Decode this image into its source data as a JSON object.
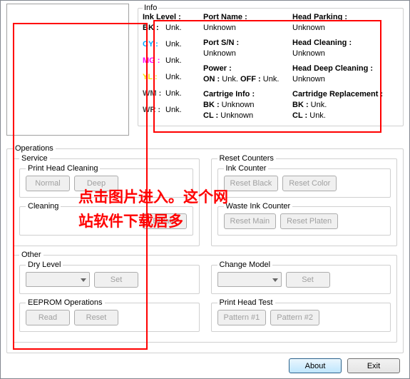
{
  "info": {
    "legend": "Info",
    "ink_level_label": "Ink Level :",
    "inks": {
      "bk": {
        "label": "BK :",
        "value": "Unk."
      },
      "cy": {
        "label": "CY :",
        "value": "Unk."
      },
      "mg": {
        "label": "MG :",
        "value": "Unk."
      },
      "yl": {
        "label": "YL :",
        "value": "Unk."
      },
      "wm": {
        "label": "WM :",
        "value": "Unk."
      },
      "wr": {
        "label": "WR :",
        "value": "Unk."
      }
    },
    "port_name": {
      "label": "Port Name :",
      "value": "Unknown"
    },
    "port_sn": {
      "label": "Port S/N :",
      "value": "Unknown"
    },
    "power": {
      "label": "Power :",
      "on_label": "ON :",
      "on_value": "Unk.",
      "off_label": "OFF :",
      "off_value": "Unk."
    },
    "cartridge_info": {
      "label": "Cartrige Info :",
      "bk_label": "BK :",
      "bk_value": "Unknown",
      "cl_label": "CL :",
      "cl_value": "Unknown"
    },
    "head_parking": {
      "label": "Head Parking :",
      "value": "Unknown"
    },
    "head_cleaning": {
      "label": "Head Cleaning :",
      "value": "Unknown"
    },
    "head_deep": {
      "label": "Head Deep Cleaning :",
      "value": "Unknown"
    },
    "cart_replace": {
      "label": "Cartridge Replacement :",
      "bk_label": "BK :",
      "bk_value": "Unk.",
      "cl_label": "CL :",
      "cl_value": "Unk."
    }
  },
  "operations": {
    "legend": "Operations",
    "service": {
      "legend": "Service",
      "phc_legend": "Print Head Cleaning",
      "normal": "Normal",
      "deep": "Deep",
      "cleaning_legend": "Cleaning",
      "bplate": "BPlate"
    },
    "reset": {
      "legend": "Reset Counters",
      "ink_legend": "Ink Counter",
      "reset_black": "Reset Black",
      "reset_color": "Reset Color",
      "waste_legend": "Waste Ink Counter",
      "reset_main": "Reset Main",
      "reset_platen": "Reset Platen"
    },
    "other": {
      "legend": "Other",
      "dry_legend": "Dry Level",
      "set": "Set",
      "change_legend": "Change Model",
      "eeprom_legend": "EEPROM Operations",
      "read": "Read",
      "reset": "Reset",
      "pht_legend": "Print Head Test",
      "p1": "Pattern #1",
      "p2": "Pattern #2"
    }
  },
  "footer": {
    "about": "About",
    "exit": "Exit"
  },
  "overlay": "点击图片进入。这个网站软件下载居多"
}
